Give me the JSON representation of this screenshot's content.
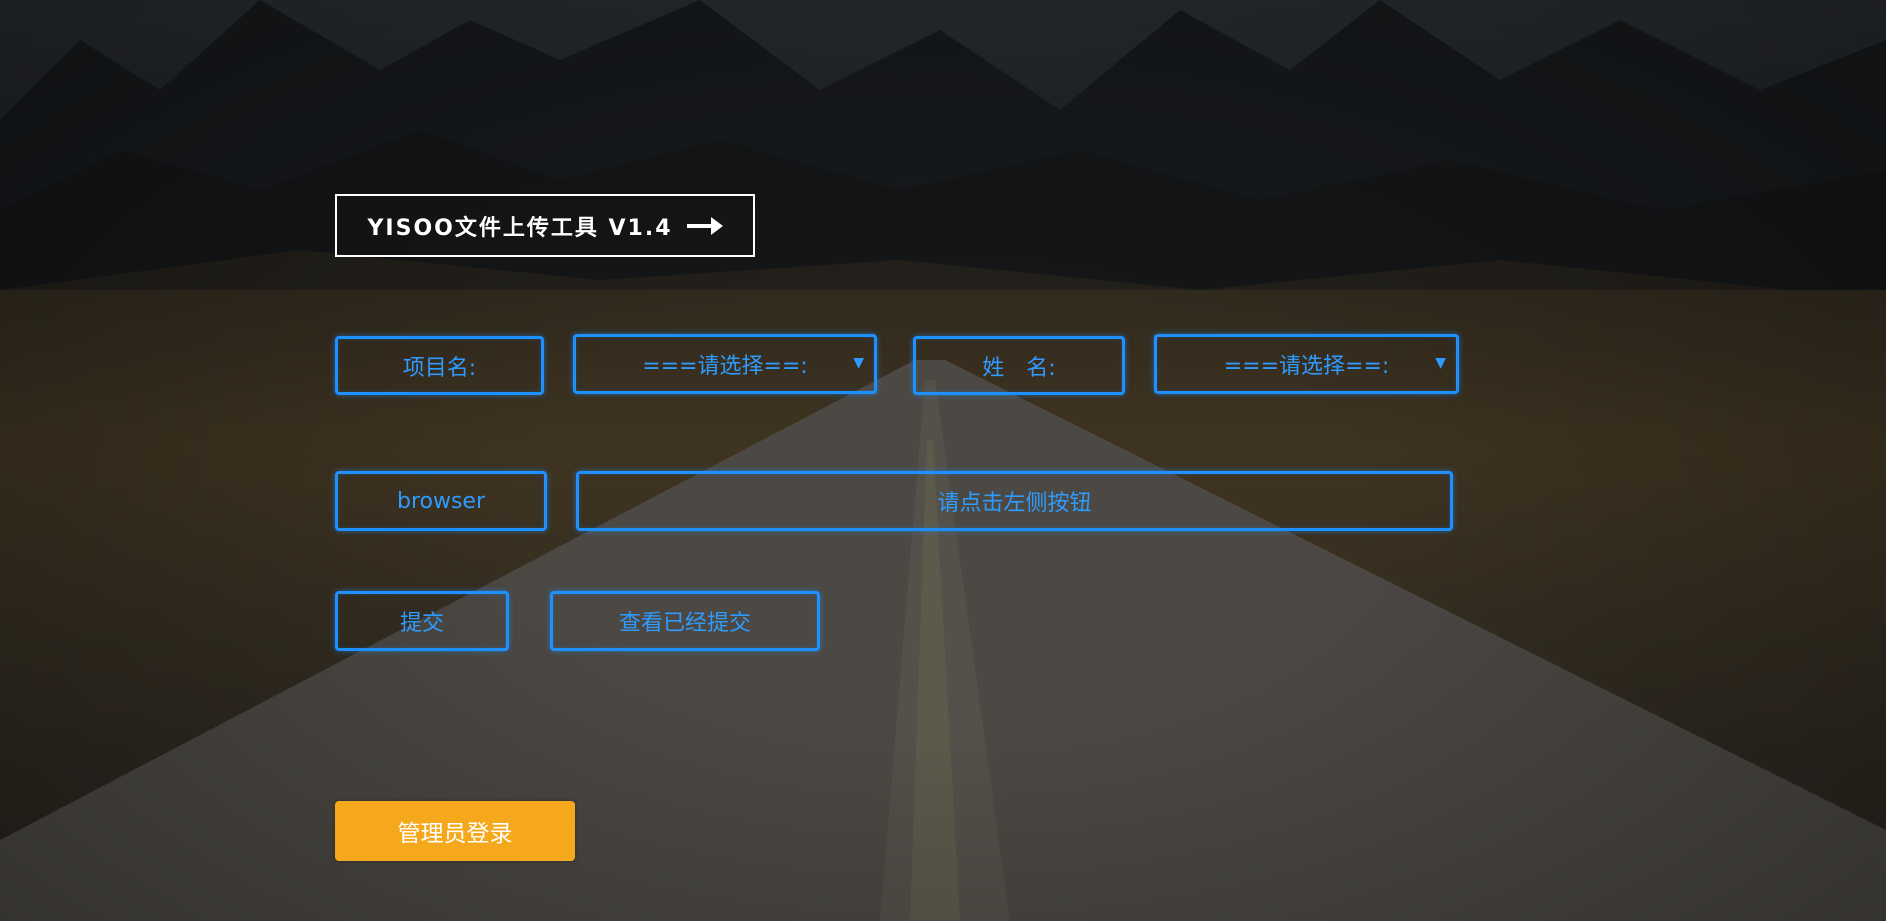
{
  "header": {
    "title": "YISOO文件上传工具 V1.4",
    "arrow_icon": "arrow-right-icon"
  },
  "form": {
    "project_label": "项目名:",
    "project_select": {
      "selected": "===请选择==:"
    },
    "name_label": "姓　名:",
    "name_select": {
      "selected": "===请选择==:"
    },
    "browse_button": "browser",
    "file_display": "请点击左侧按钮",
    "submit_button": "提交",
    "view_submitted_button": "查看已经提交",
    "admin_login_button": "管理员登录"
  },
  "colors": {
    "accent": "#1e90ff",
    "accent_text": "#2e9bff",
    "admin_button": "#f6a81d",
    "title_border": "#ffffff"
  }
}
